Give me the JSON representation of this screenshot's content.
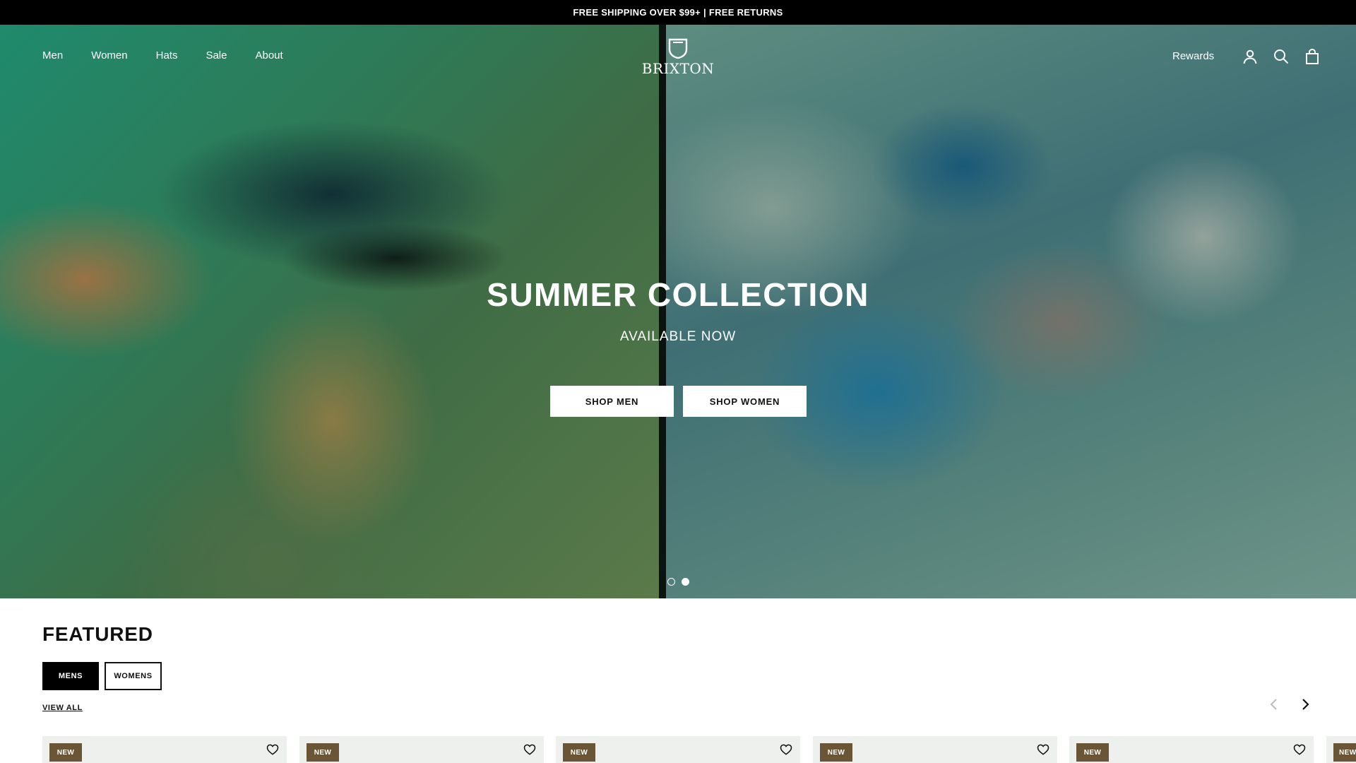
{
  "announcement": {
    "text": "FREE SHIPPING OVER $99+ | FREE RETURNS"
  },
  "header": {
    "nav": [
      "Men",
      "Women",
      "Hats",
      "Sale",
      "About"
    ],
    "logo_text": "BRIXTON",
    "rewards_label": "Rewards",
    "icons": [
      "account-icon",
      "search-icon",
      "bag-icon"
    ]
  },
  "hero": {
    "title": "SUMMER COLLECTION",
    "subtitle": "AVAILABLE NOW",
    "buttons": [
      "SHOP MEN",
      "SHOP WOMEN"
    ],
    "slides": {
      "count": 2,
      "active": 2
    }
  },
  "featured": {
    "title": "FEATURED",
    "tabs": [
      {
        "label": "MENS",
        "active": true
      },
      {
        "label": "WOMENS",
        "active": false
      }
    ],
    "view_all": "VIEW ALL",
    "products": [
      {
        "badge": "NEW"
      },
      {
        "badge": "NEW"
      },
      {
        "badge": "NEW"
      },
      {
        "badge": "NEW"
      },
      {
        "badge": "NEW"
      },
      {
        "badge": "NEW"
      }
    ]
  },
  "colors": {
    "badge": "#6b5537",
    "announcement_bg": "#000000",
    "accent": "#000000"
  }
}
